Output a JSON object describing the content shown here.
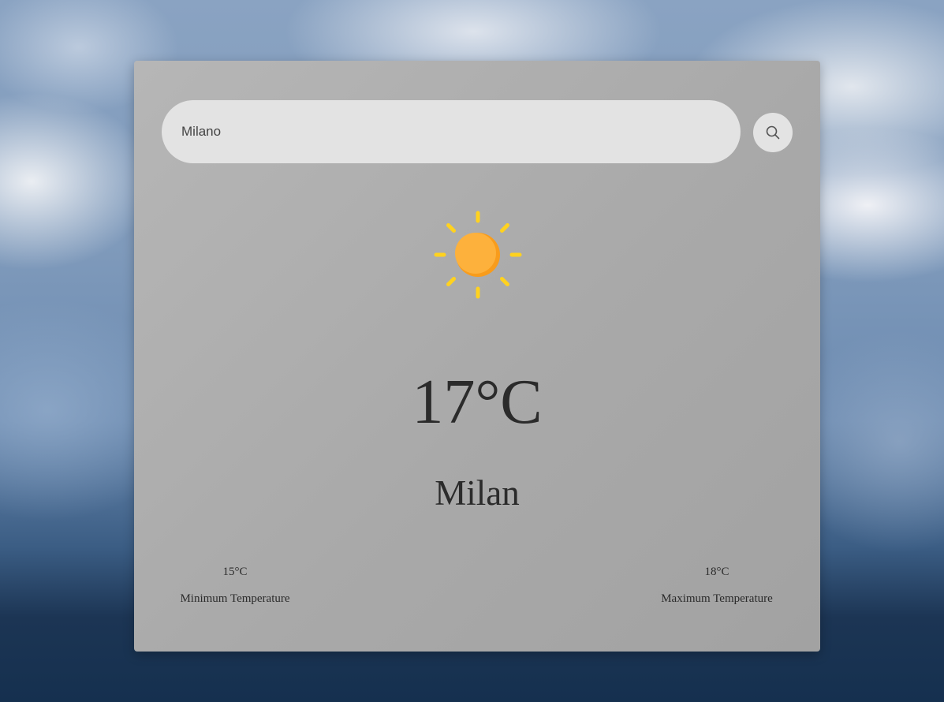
{
  "search": {
    "value": "Milano"
  },
  "weather": {
    "icon": "sun-icon",
    "temperature": "17°C",
    "city": "Milan",
    "min_temp": "15°C",
    "min_label": "Minimum Temperature",
    "max_temp": "18°C",
    "max_label": "Maximum Temperature"
  },
  "colors": {
    "sun_body": "#FDB13C",
    "sun_shade": "#F89C1C",
    "sun_rays": "#FFD21F",
    "text": "#2B2B2B",
    "input_bg": "#E3E3E3"
  }
}
